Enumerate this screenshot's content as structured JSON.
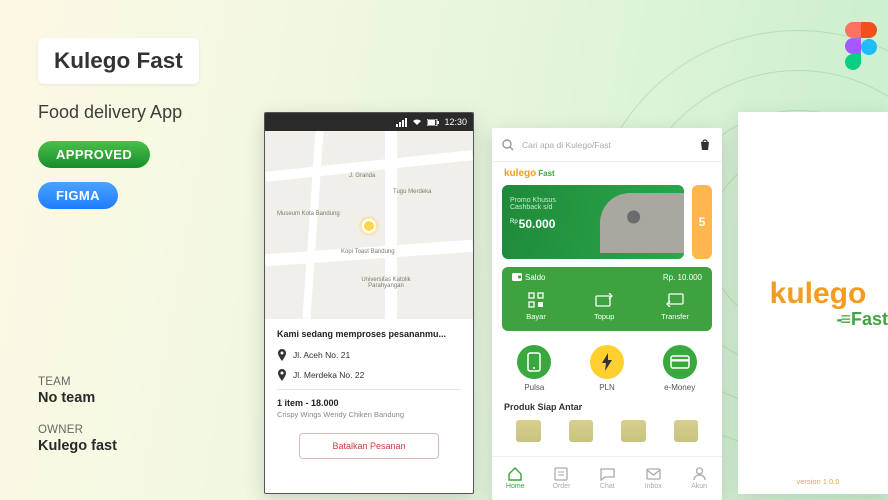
{
  "header": {
    "title": "Kulego Fast",
    "subtitle": "Food delivery App",
    "badge_approved": "APPROVED",
    "badge_figma": "FIGMA"
  },
  "meta": {
    "team_label": "TEAM",
    "team_value": "No team",
    "owner_label": "OWNER",
    "owner_value": "Kulego fast"
  },
  "phone1": {
    "status_time": "12:30",
    "map": {
      "poi1": "J. Granda",
      "poi2": "Tugu Merdeka",
      "poi3": "Museum Kota Bandung",
      "poi4": "Kopi Toast Bandung",
      "poi5": "Universitas Katolik Parahyangan"
    },
    "processing": "Kami sedang memproses pesananmu...",
    "addr1": "Jl. Aceh No. 21",
    "addr2": "Jl. Merdeka No. 22",
    "summary": "1 item - 18.000",
    "summary_sub": "Crispy Wings Wendy Chiken Bandung",
    "cancel": "Batalkan Pesanan"
  },
  "phone2": {
    "search_placeholder": "Cari apa di Kulego/Fast",
    "brand_k": "kulego",
    "brand_f": "Fast",
    "promo_line1": "Promo Khusus",
    "promo_line2": "Cashback s/d",
    "promo_amount": "50.000",
    "promo_side": "5",
    "wallet_label": "Saldo",
    "wallet_balance": "Rp. 10.000",
    "wallet_actions": [
      "Bayar",
      "Topup",
      "Transfer"
    ],
    "services": [
      {
        "label": "Pulsa"
      },
      {
        "label": "PLN"
      },
      {
        "label": "e-Money"
      }
    ],
    "section": "Produk Siap Antar",
    "tabs": [
      "Home",
      "Order",
      "Chat",
      "Inbox",
      "Akun"
    ]
  },
  "splash": {
    "brand": "kulego",
    "fast": "Fast",
    "version": "version 1.0.0"
  }
}
